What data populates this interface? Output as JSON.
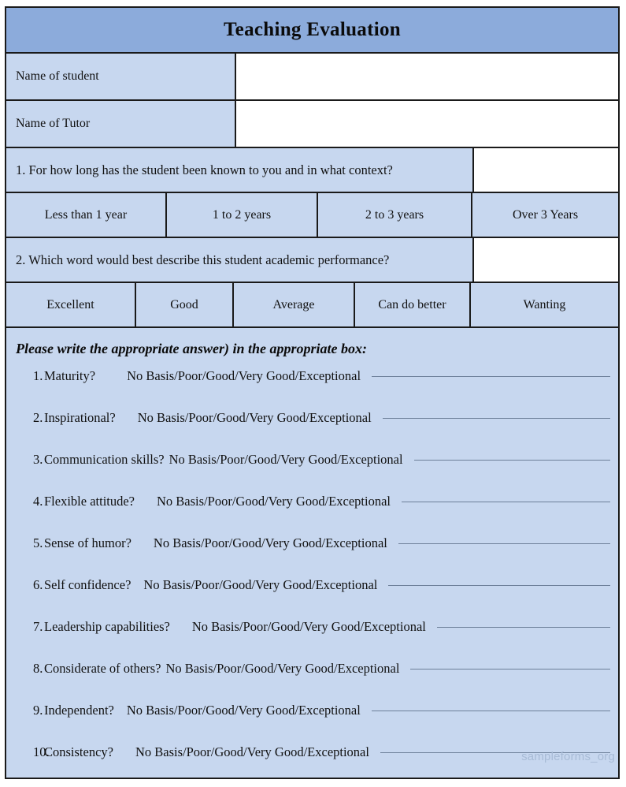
{
  "header": {
    "title": "Teaching Evaluation"
  },
  "identity_rows": [
    {
      "label": "Name of student",
      "value": ""
    },
    {
      "label": "Name of Tutor",
      "value": ""
    }
  ],
  "questions": [
    {
      "prompt": "1. For how long has the student been known to you and in what context?",
      "answer": "",
      "options": [
        "Less than 1 year",
        "1 to 2 years",
        "2 to 3 years",
        "Over 3 Years"
      ]
    },
    {
      "prompt": "2. Which word would best describe this student academic performance?",
      "answer": "",
      "options": [
        "Excellent",
        "Good",
        "Average",
        "Can do better",
        "Wanting"
      ]
    }
  ],
  "rating_section": {
    "instruction": "Please write the appropriate answer) in the appropriate box:",
    "scale_text": "No Basis/Poor/Good/Very Good/Exceptional",
    "items": [
      {
        "number": "1.",
        "trait": "Maturity?",
        "scale": "No Basis/Poor/Good/Very Good/Exceptional",
        "answer": ""
      },
      {
        "number": "2.",
        "trait": "Inspirational?",
        "scale": "No Basis/Poor/Good/Very Good/Exceptional",
        "answer": ""
      },
      {
        "number": "3.",
        "trait": "Communication skills?",
        "scale": "No Basis/Poor/Good/Very Good/Exceptional",
        "answer": ""
      },
      {
        "number": "4.",
        "trait": "Flexible attitude?",
        "scale": "No Basis/Poor/Good/Very Good/Exceptional",
        "answer": ""
      },
      {
        "number": "5.",
        "trait": "Sense of humor?",
        "scale": "No Basis/Poor/Good/Very Good/Exceptional",
        "answer": ""
      },
      {
        "number": "6.",
        "trait": "Self confidence?",
        "scale": "No Basis/Poor/Good/Very Good/Exceptional",
        "answer": ""
      },
      {
        "number": "7.",
        "trait": "Leadership capabilities?",
        "scale": "No Basis/Poor/Good/Very Good/Exceptional",
        "answer": ""
      },
      {
        "number": "8.",
        "trait": "Considerate of others?",
        "scale": "No Basis/Poor/Good/Very Good/Exceptional",
        "answer": ""
      },
      {
        "number": "9.",
        "trait": "Independent?",
        "scale": "No Basis/Poor/Good/Very Good/Exceptional",
        "answer": ""
      },
      {
        "number": "10.",
        "trait": "Consistency?",
        "scale": "No Basis/Poor/Good/Very Good/Exceptional",
        "answer": ""
      }
    ]
  },
  "watermark": "sampleforms_org",
  "colors": {
    "header_blue": "#8cabdb",
    "body_blue": "#c7d7ef",
    "blank_white": "#ffffff",
    "border": "#1a1a1a",
    "rule_line": "#6d7f99",
    "watermark": "#a8bbd6"
  }
}
